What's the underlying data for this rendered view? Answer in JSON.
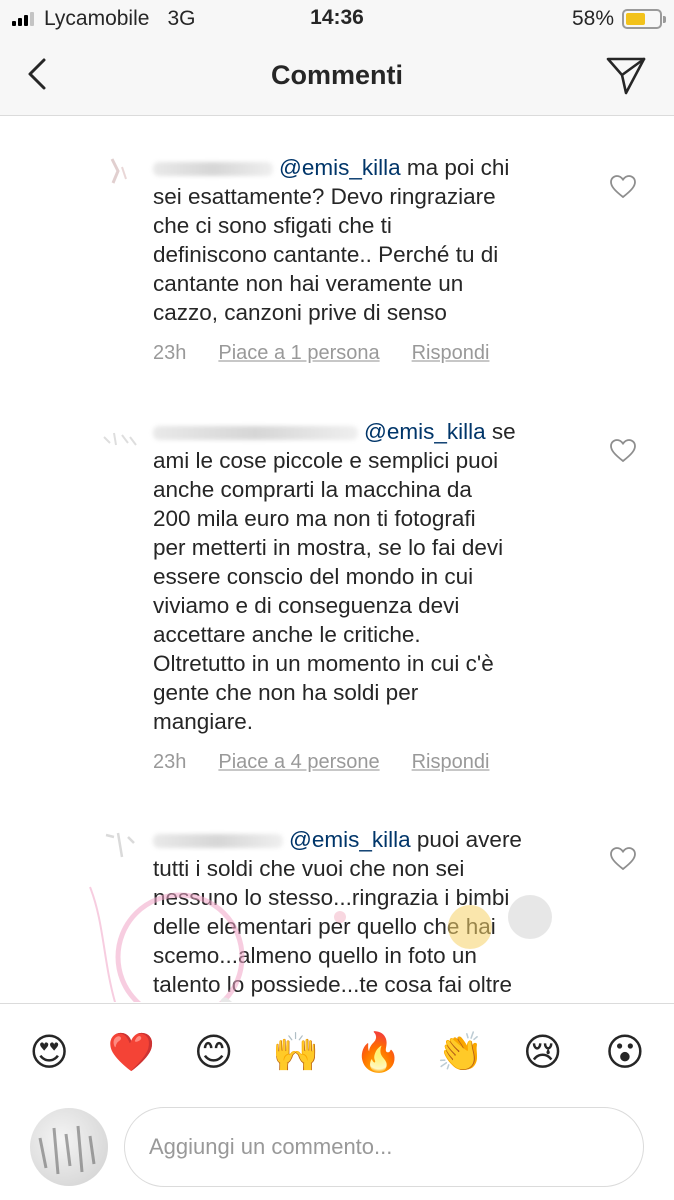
{
  "status_bar": {
    "carrier": "Lycamobile",
    "network": "3G",
    "time": "14:36",
    "battery_percent": "58%",
    "battery_level": 0.58,
    "signal_bars_active": 3,
    "signal_bars_total": 4
  },
  "nav": {
    "title": "Commenti",
    "back_icon": "chevron-left-icon",
    "send_icon": "paper-plane-icon"
  },
  "comments": [
    {
      "mention": "@emis_killa",
      "lines": [
        " ma poi chi",
        "sei esattamente? Devo ringraziare",
        "che ci sono sfigati che ti",
        "definiscono cantante.. Perché tu  di",
        "cantante non hai veramente un",
        "cazzo, canzoni prive di senso"
      ],
      "time": "23h",
      "likes": "Piace a 1 persona",
      "reply": "Rispondi"
    },
    {
      "mention": "@emis_killa",
      "lines": [
        " se",
        "ami le cose piccole e semplici puoi",
        "anche comprarti la macchina da",
        "200 mila euro ma non ti fotografi",
        "per metterti in mostra, se lo fai devi",
        "essere conscio del mondo in  cui",
        "viviamo e di conseguenza devi",
        "accettare anche le critiche.",
        "Oltretutto in un momento in cui c'è",
        "gente che non ha soldi per",
        "mangiare."
      ],
      "time": "23h",
      "likes": "Piace a 4 persone",
      "reply": "Rispondi"
    },
    {
      "mention": "@emis_killa",
      "lines": [
        " puoi avere",
        "tutti i soldi che vuoi che non sei",
        "nessuno lo stesso...ringrazia i bimbi",
        "delle elementari per quello che hai",
        "scemo...almeno quello in foto un",
        "talento lo possiede...te cosa fai oltre"
      ]
    }
  ],
  "emoji_bar": [
    "😍",
    "❤️",
    "😊",
    "🙌",
    "🔥",
    "👏",
    "😢",
    "😮"
  ],
  "input": {
    "placeholder": "Aggiungi un commento..."
  },
  "colors": {
    "mention": "#003569",
    "meta_text": "#999999",
    "battery": "#f2c21b",
    "bar_background": "#f7f7f7"
  }
}
